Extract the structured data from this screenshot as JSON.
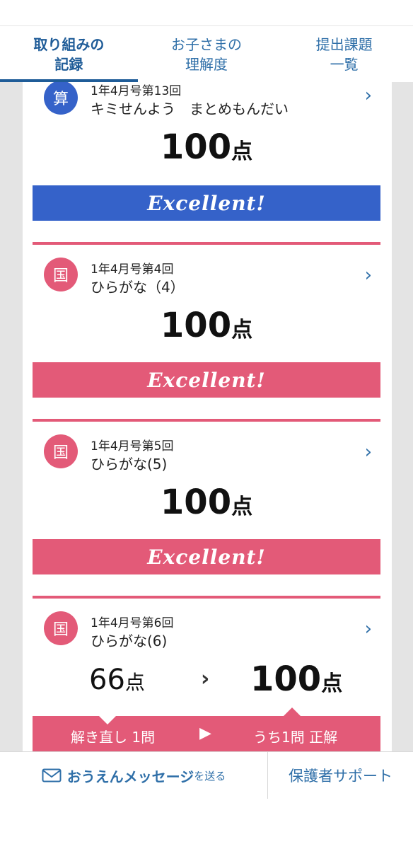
{
  "tabs": [
    {
      "label": "取り組みの\n記録",
      "active": true
    },
    {
      "label": "お子さまの\n理解度",
      "active": false
    },
    {
      "label": "提出課題\n一覧",
      "active": false
    }
  ],
  "cards": [
    {
      "badge": "算",
      "meta": "1年4月号第13回",
      "title": "キミせんよう　まとめもんだい",
      "score": "100",
      "unit": "点",
      "banner": "Excellent!"
    },
    {
      "badge": "国",
      "meta": "1年4月号第4回",
      "title": "ひらがな（4）",
      "score": "100",
      "unit": "点",
      "banner": "Excellent!"
    },
    {
      "badge": "国",
      "meta": "1年4月号第5回",
      "title": "ひらがな(5)",
      "score": "100",
      "unit": "点",
      "banner": "Excellent!"
    },
    {
      "badge": "国",
      "meta": "1年4月号第6回",
      "title": "ひらがな(6)",
      "score_before": "66",
      "score_after": "100",
      "unit": "点",
      "arrow": "›",
      "retry_label": "解き直し 1問",
      "retry_arrow": "▶",
      "retry_result": "うち1問 正解"
    }
  ],
  "chevron": "›",
  "footer": {
    "message_big": "おうえんメッセージ",
    "message_small": "を送る",
    "support": "保護者サポート"
  },
  "colors": {
    "math": "#3562c9",
    "japanese": "#e35a78",
    "accent": "#2f6fa8"
  }
}
